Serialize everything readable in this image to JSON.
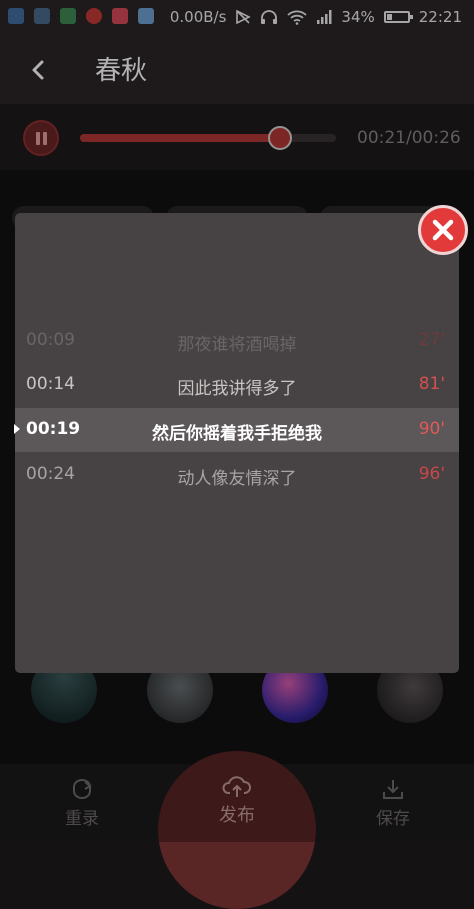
{
  "status_bar": {
    "network_speed": "0.00B/s",
    "battery": "34%",
    "battery_level": 0.34,
    "time": "22:21"
  },
  "header": {
    "title": "春秋"
  },
  "player": {
    "time": "00:21/00:26",
    "progress": 0.78
  },
  "lyrics": [
    {
      "time": "00:09",
      "text": "那夜谁将酒喝掉",
      "score": "27'"
    },
    {
      "time": "00:14",
      "text": "因此我讲得多了",
      "score": "81'"
    },
    {
      "time": "00:19",
      "text": "然后你摇着我手拒绝我",
      "score": "90'"
    },
    {
      "time": "00:24",
      "text": "动人像友情深了",
      "score": "96'"
    }
  ],
  "bottom_bar": {
    "rerecord": "重录",
    "publish": "发布",
    "save": "保存"
  },
  "colors": {
    "accent": "#b33737",
    "close": "#e23a3a"
  }
}
